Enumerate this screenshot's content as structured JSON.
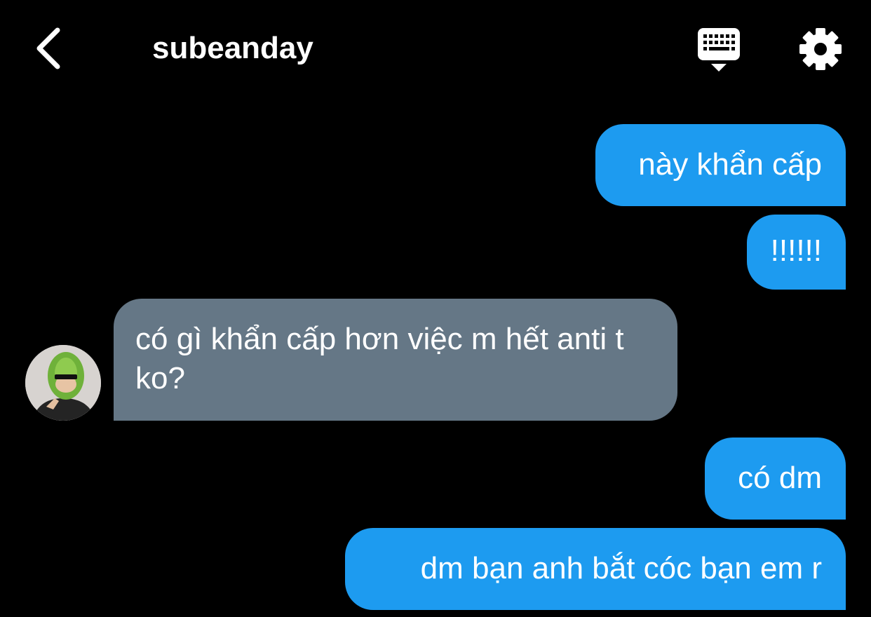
{
  "header": {
    "title": "subeanday",
    "back_icon": "chevron-left-icon",
    "keyboard_icon": "keyboard-icon",
    "settings_icon": "gear-icon"
  },
  "messages": [
    {
      "direction": "sent",
      "text": "này khẩn cấp"
    },
    {
      "direction": "sent",
      "text": "!!!!!!"
    },
    {
      "direction": "received",
      "text": "có gì khẩn cấp hơn việc m hết anti t ko?"
    },
    {
      "direction": "sent",
      "text": "có dm"
    },
    {
      "direction": "sent",
      "text": "dm bạn anh bắt cóc bạn em r"
    }
  ],
  "colors": {
    "background": "#000000",
    "sent_bubble": "#1d9bf0",
    "received_bubble": "#657786",
    "text": "#ffffff"
  }
}
